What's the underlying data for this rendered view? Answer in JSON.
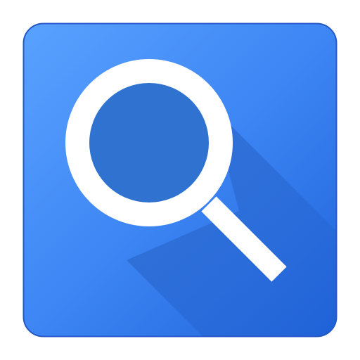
{
  "app_icon": {
    "icon_name": "search-icon",
    "colors": {
      "tile_light": "#5aa2ff",
      "tile_mid": "#3d86f4",
      "tile_dark": "#1f63db",
      "tile_border": "#2458c8",
      "lens_fill": "#2f72cf",
      "glyph": "#ffffff",
      "long_shadow": "#1b4fae"
    }
  }
}
